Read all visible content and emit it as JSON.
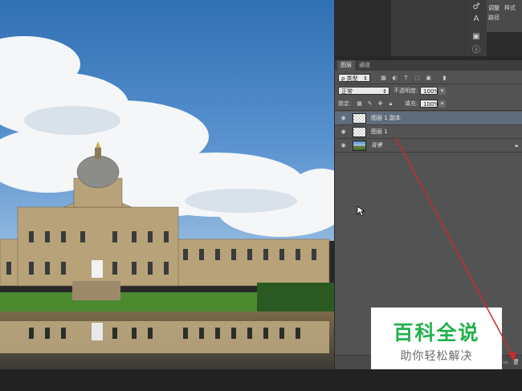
{
  "top_right_panel": {
    "rows": [
      "调整",
      "样式",
      "路径"
    ]
  },
  "layers_panel": {
    "tabs": [
      {
        "label": "图层",
        "active": true
      },
      {
        "label": "通道",
        "active": false
      }
    ],
    "filter_kind": "类型",
    "blend_mode": "正常",
    "opacity_label": "不透明度:",
    "opacity_value": "100%",
    "lock_label": "锁定:",
    "fill_label": "填充:",
    "fill_value": "100%",
    "layers": [
      {
        "name": "图层 1 副本",
        "selected": true,
        "thumb": "transparent"
      },
      {
        "name": "图层 1",
        "selected": false,
        "thumb": "transparent"
      },
      {
        "name": "背景",
        "selected": false,
        "thumb": "image"
      }
    ]
  },
  "watermark": {
    "main": "百科全说",
    "sub": "助你轻松解决",
    "color": "#22b14c"
  },
  "annotation": {
    "arrow_color": "#cc2a2a"
  }
}
